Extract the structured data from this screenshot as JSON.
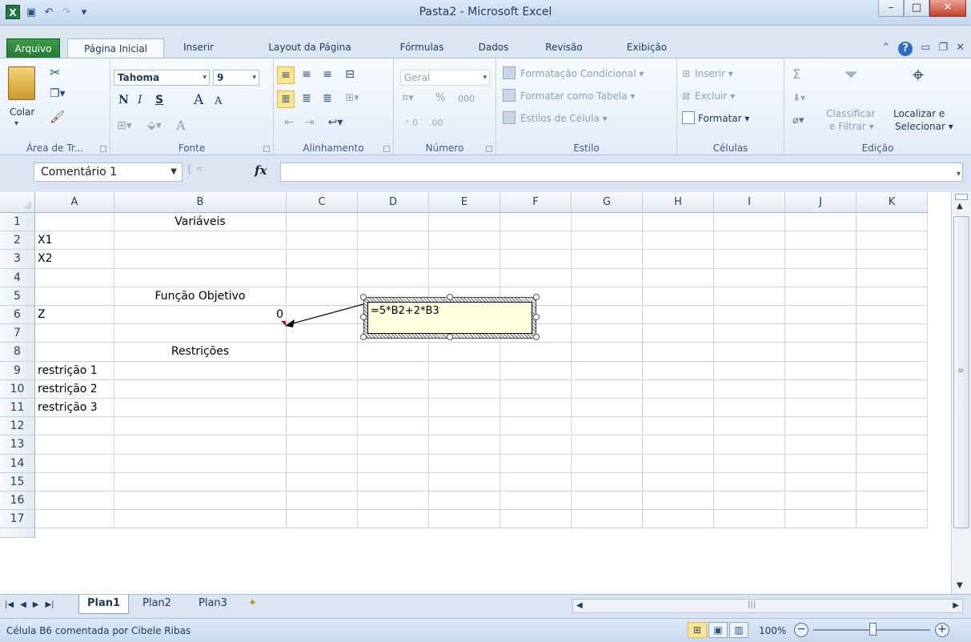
{
  "window": {
    "title": "Pasta2 - Microsoft Excel",
    "app_icon": "X",
    "colors": {
      "file_tab": "#2a8a3a",
      "close": "#c6412b",
      "accent": "#fde58e"
    }
  },
  "qat": {
    "icons": [
      "save-icon",
      "undo-icon",
      "redo-icon",
      "customize-icon"
    ]
  },
  "ribbon_tabs": {
    "file": "Arquivo",
    "active": "Página Inicial",
    "others": [
      "Inserir",
      "Layout da Página",
      "Fórmulas",
      "Dados",
      "Revisão",
      "Exibição"
    ]
  },
  "clipboard": {
    "paste": "Colar",
    "label": "Área de Tr..."
  },
  "font": {
    "name": "Tahoma",
    "size": "9",
    "bold": "N",
    "italic": "I",
    "underline": "S",
    "grow": "A",
    "shrink": "A",
    "color": "A",
    "label": "Fonte"
  },
  "alignment": {
    "label": "Alinhamento"
  },
  "number": {
    "format": "Geral",
    "percent": "%",
    "thousands": "000",
    "label": "Número"
  },
  "styles": {
    "conditional": "Formatação Condicional",
    "as_table": "Formatar como Tabela",
    "cell_styles": "Estilos de Célula",
    "label": "Estilo"
  },
  "cells": {
    "insert": "Inserir",
    "delete": "Excluir",
    "format": "Formatar",
    "label": "Células"
  },
  "editing": {
    "sort_line1": "Classificar",
    "sort_line2": "e Filtrar",
    "find_line1": "Localizar e",
    "find_line2": "Selecionar",
    "label": "Edição",
    "sigma": "Σ"
  },
  "formula_bar": {
    "name_box": "Comentário 1",
    "fx": "fx",
    "content": ""
  },
  "columns": [
    "A",
    "B",
    "C",
    "D",
    "E",
    "F",
    "G",
    "H",
    "I",
    "J",
    "K"
  ],
  "rows": [
    "1",
    "2",
    "3",
    "4",
    "5",
    "6",
    "7",
    "8",
    "9",
    "10",
    "11",
    "12",
    "13",
    "14",
    "15",
    "16",
    "17"
  ],
  "cells_data": {
    "B1": "Variáveis",
    "A2": "X1",
    "A3": "X2",
    "B5": "Função Objetivo",
    "A6": "Z",
    "B6": "0",
    "B8": "Restrições",
    "A9": "restrição 1",
    "A10": "restrição 2",
    "A11": "restrição 3"
  },
  "comment": {
    "text": "=5*B2+2*B3"
  },
  "sheets": {
    "tabs": [
      "Plan1",
      "Plan2",
      "Plan3"
    ],
    "active": "Plan1"
  },
  "status": {
    "text": "Célula B6 comentada por Cibele Ribas",
    "zoom": "100%"
  }
}
